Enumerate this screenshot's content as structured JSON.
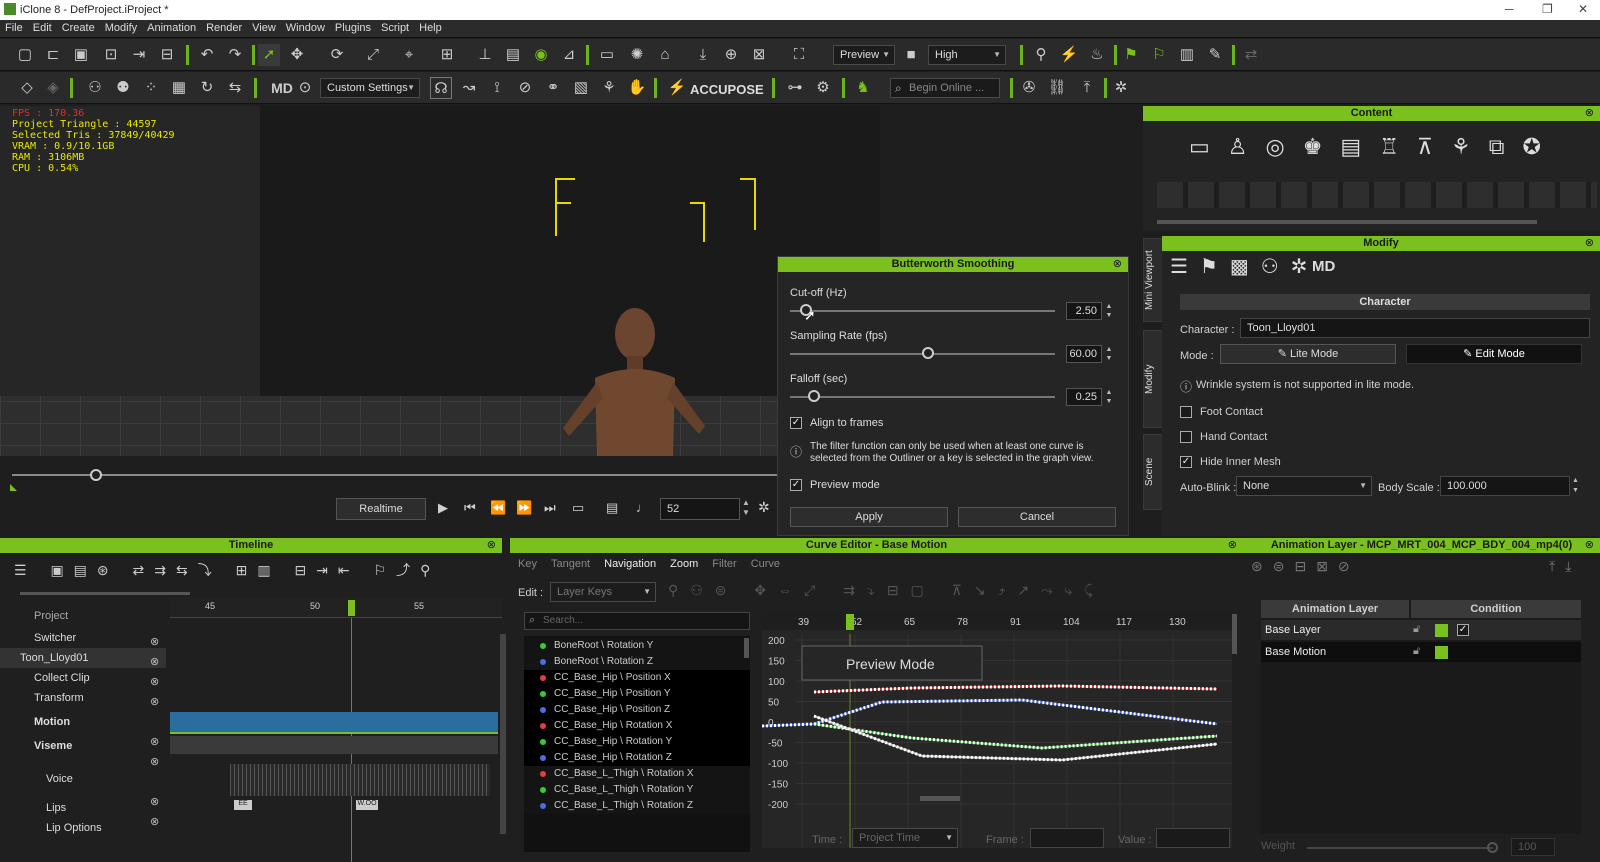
{
  "window": {
    "title": "iClone 8 - DefProject.iProject *"
  },
  "menu": [
    "File",
    "Edit",
    "Create",
    "Modify",
    "Animation",
    "Render",
    "View",
    "Window",
    "Plugins",
    "Script",
    "Help"
  ],
  "toolbar1": {
    "preview_label": "Preview",
    "quality_label": "High"
  },
  "toolbar2": {
    "settings_label": "Custom Settings",
    "accupose_label": "ACCUPOSE",
    "search_placeholder": "Begin Online ...",
    "md_label": "MD"
  },
  "stats": {
    "fps": "FPS : 170.36",
    "triangles": "Project Triangle : 44597",
    "tris": "Selected Tris : 37849/40429",
    "vram": "VRAM : 0.9/10.1GB",
    "ram": "RAM : 3106MB",
    "cpu": "CPU : 0.54%"
  },
  "playback": {
    "realtime_label": "Realtime",
    "frame": "52"
  },
  "dialog": {
    "title": "Butterworth Smoothing",
    "cutoff": {
      "label": "Cut-off (Hz)",
      "value": "2.50"
    },
    "sampling": {
      "label": "Sampling Rate (fps)",
      "value": "60.00"
    },
    "falloff": {
      "label": "Falloff (sec)",
      "value": "0.25"
    },
    "align_label": "Align to frames",
    "info_text": "The filter function can only be used when at least one curve is selected from the Outliner or a key is selected in the graph view.",
    "preview_label": "Preview mode",
    "apply_label": "Apply",
    "cancel_label": "Cancel"
  },
  "content": {
    "title": "Content"
  },
  "modify": {
    "title": "Modify",
    "section": "Character",
    "character_label": "Character :",
    "character_value": "Toon_Lloyd01",
    "mode_label": "Mode :",
    "lite_mode": "Lite Mode",
    "edit_mode": "Edit Mode",
    "wrinkle_note": "Wrinkle system is not supported in lite mode.",
    "foot_contact": "Foot Contact",
    "hand_contact": "Hand Contact",
    "hide_inner_mesh": "Hide Inner Mesh",
    "autoblink_label": "Auto-Blink :",
    "autoblink_value": "None",
    "bodyscale_label": "Body Scale :",
    "bodyscale_value": "100.000"
  },
  "side_tabs": [
    "Mini Viewport",
    "Modify",
    "Scene"
  ],
  "timeline": {
    "title": "Timeline",
    "ruler": [
      "45",
      "50",
      "55"
    ],
    "rows": [
      "Project",
      "Switcher",
      "Toon_Lloyd01",
      "Collect Clip",
      "Transform",
      "Motion",
      "Viseme",
      "Voice",
      "Lips",
      "Lip Options"
    ],
    "lips_keys": [
      "EE",
      "W.OO"
    ]
  },
  "curve_editor": {
    "title": "Curve Editor - Base Motion",
    "tabs": [
      "Key",
      "Tangent",
      "Navigation",
      "Zoom",
      "Filter",
      "Curve"
    ],
    "edit_label": "Edit :",
    "edit_value": "Layer Keys",
    "search_placeholder": "Search...",
    "curves": [
      {
        "name": "BoneRoot \\ Rotation Y",
        "color": "#3cc83c"
      },
      {
        "name": "BoneRoot \\ Rotation Z",
        "color": "#4a6ee8"
      },
      {
        "name": "CC_Base_Hip \\ Position X",
        "color": "#e04040"
      },
      {
        "name": "CC_Base_Hip \\ Position Y",
        "color": "#3cc83c"
      },
      {
        "name": "CC_Base_Hip \\ Position Z",
        "color": "#4a6ee8"
      },
      {
        "name": "CC_Base_Hip \\ Rotation X",
        "color": "#e04040"
      },
      {
        "name": "CC_Base_Hip \\ Rotation Y",
        "color": "#3cc83c"
      },
      {
        "name": "CC_Base_Hip \\ Rotation Z",
        "color": "#4a6ee8"
      },
      {
        "name": "CC_Base_L_Thigh \\ Rotation X",
        "color": "#e04040"
      },
      {
        "name": "CC_Base_L_Thigh \\ Rotation Y",
        "color": "#3cc83c"
      },
      {
        "name": "CC_Base_L_Thigh \\ Rotation Z",
        "color": "#4a6ee8"
      }
    ],
    "ruler": [
      "39",
      "52",
      "65",
      "78",
      "91",
      "104",
      "117",
      "130"
    ],
    "yaxis": [
      "200",
      "150",
      "100",
      "50",
      "0",
      "-50",
      "-100",
      "-150",
      "-200"
    ],
    "preview_overlay": "Preview Mode",
    "time_label": "Time :",
    "time_value": "Project Time",
    "frame_label": "Frame :",
    "value_label": "Value :"
  },
  "anim_layer": {
    "title": "Animation Layer - MCP_MRT_004_MCP_BDY_004_mp4(0)",
    "col_layer": "Animation Layer",
    "col_condition": "Condition",
    "layers": [
      "Base Layer",
      "Base Motion"
    ],
    "weight_label": "Weight",
    "weight_value": "100"
  }
}
